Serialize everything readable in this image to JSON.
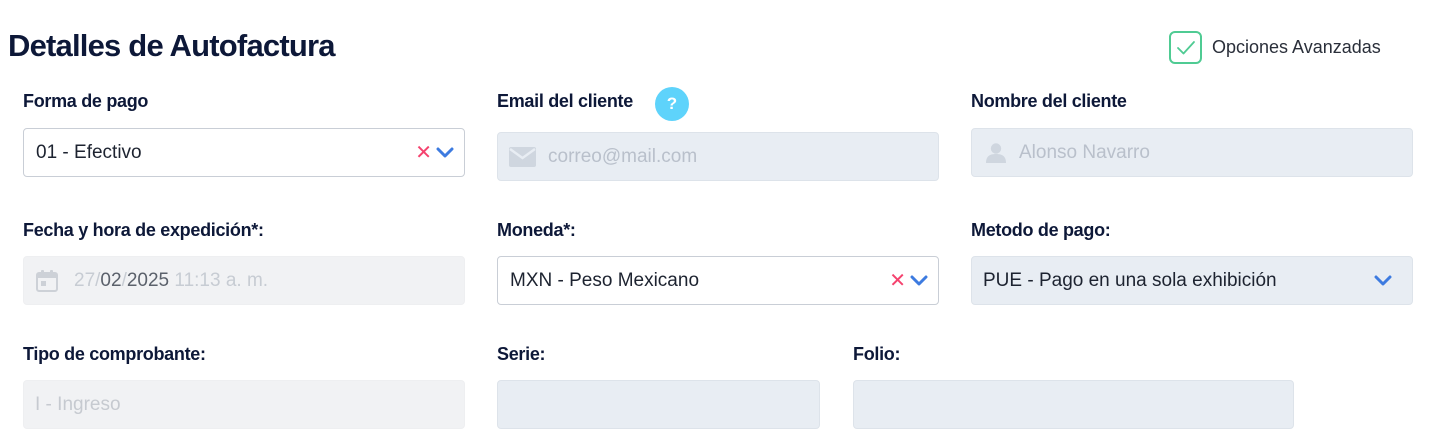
{
  "page": {
    "title": "Detalles de Autofactura"
  },
  "advanced": {
    "label": "Opciones Avanzadas",
    "checked": true,
    "check_color": "#4fcb93"
  },
  "payment_form": {
    "label": "Forma de pago",
    "value": "01 - Efectivo"
  },
  "client_email": {
    "label": "Email del cliente",
    "placeholder": "correo@mail.com",
    "help": "?"
  },
  "client_name": {
    "label": "Nombre del cliente",
    "placeholder": "Alonso Navarro"
  },
  "issue_date": {
    "label": "Fecha y hora de expedición*:",
    "day": "27",
    "sep1": "/",
    "month": "02",
    "sep2": "/",
    "year": "2025",
    "time": "11:13 a. m."
  },
  "currency": {
    "label": "Moneda*:",
    "value": "MXN - Peso Mexicano"
  },
  "payment_method": {
    "label": "Metodo de pago:",
    "value": "PUE - Pago en una sola exhibición"
  },
  "receipt_type": {
    "label": "Tipo de comprobante:",
    "value": "I - Ingreso"
  },
  "series": {
    "label": "Serie:",
    "value": ""
  },
  "folio": {
    "label": "Folio:",
    "value": ""
  },
  "colors": {
    "accent_blue": "#3d7be0",
    "clear_red": "#f5426e",
    "help_cyan": "#5ed3fb"
  }
}
